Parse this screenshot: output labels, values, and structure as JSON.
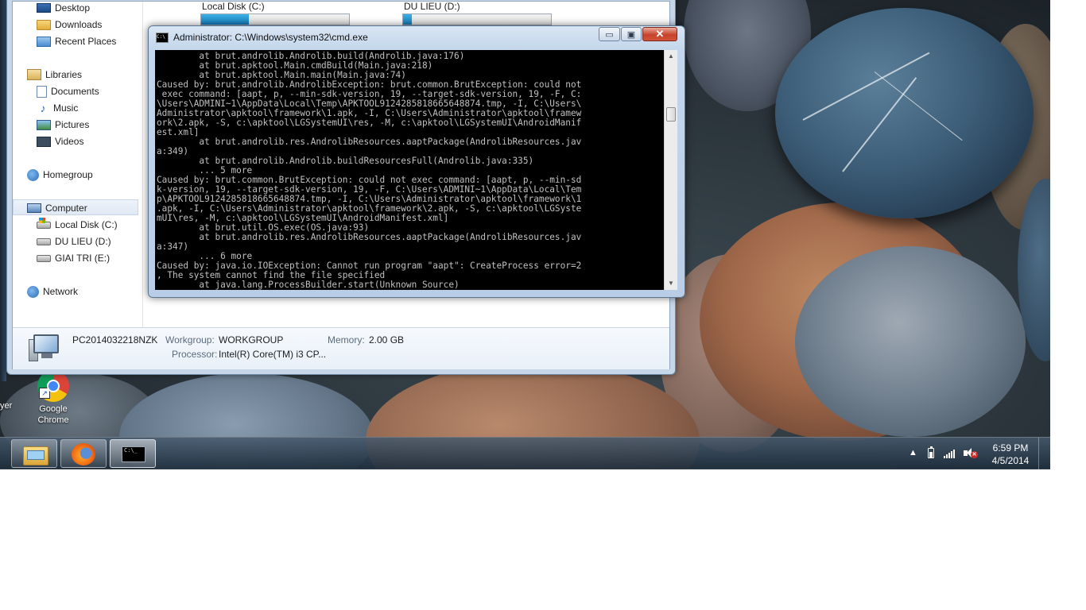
{
  "explorer": {
    "nav": {
      "desktop": "Desktop",
      "downloads": "Downloads",
      "recent_places": "Recent Places",
      "libraries": "Libraries",
      "documents": "Documents",
      "music": "Music",
      "pictures": "Pictures",
      "videos": "Videos",
      "homegroup": "Homegroup",
      "computer": "Computer",
      "local_disk": "Local Disk (C:)",
      "du_lieu": "DU LIEU (D:)",
      "giai_tri": "GIAI TRI (E:)",
      "network": "Network"
    },
    "drives": [
      {
        "label": "Local Disk (C:)",
        "used_fraction": 0.32
      },
      {
        "label": "DU LIEU (D:)",
        "used_fraction": 0.06
      }
    ],
    "details": {
      "computer_name": "PC2014032218NZK",
      "workgroup_label": "Workgroup:",
      "workgroup_value": "WORKGROUP",
      "memory_label": "Memory:",
      "memory_value": "2.00 GB",
      "processor_label": "Processor:",
      "processor_value": "Intel(R) Core(TM) i3 CP..."
    }
  },
  "cmd": {
    "title": "Administrator: C:\\Windows\\system32\\cmd.exe",
    "icon_text": "C:\\",
    "min_glyph": "▭",
    "max_glyph": "▣",
    "close_glyph": "✕",
    "output": "        at brut.androlib.Androlib.build(Androlib.java:176)\n        at brut.apktool.Main.cmdBuild(Main.java:218)\n        at brut.apktool.Main.main(Main.java:74)\nCaused by: brut.androlib.AndrolibException: brut.common.BrutException: could not\n exec command: [aapt, p, --min-sdk-version, 19, --target-sdk-version, 19, -F, C:\n\\Users\\ADMINI~1\\AppData\\Local\\Temp\\APKTOOL9124285818665648874.tmp, -I, C:\\Users\\\nAdministrator\\apktool\\framework\\1.apk, -I, C:\\Users\\Administrator\\apktool\\framew\nork\\2.apk, -S, c:\\apktool\\LGSystemUI\\res, -M, c:\\apktool\\LGSystemUI\\AndroidManif\nest.xml]\n        at brut.androlib.res.AndrolibResources.aaptPackage(AndrolibResources.jav\na:349)\n        at brut.androlib.Androlib.buildResourcesFull(Androlib.java:335)\n        ... 5 more\nCaused by: brut.common.BrutException: could not exec command: [aapt, p, --min-sd\nk-version, 19, --target-sdk-version, 19, -F, C:\\Users\\ADMINI~1\\AppData\\Local\\Tem\np\\APKTOOL9124285818665648874.tmp, -I, C:\\Users\\Administrator\\apktool\\framework\\1\n.apk, -I, C:\\Users\\Administrator\\apktool\\framework\\2.apk, -S, c:\\apktool\\LGSyste\nmUI\\res, -M, c:\\apktool\\LGSystemUI\\AndroidManifest.xml]\n        at brut.util.OS.exec(OS.java:93)\n        at brut.androlib.res.AndrolibResources.aaptPackage(AndrolibResources.jav\na:347)\n        ... 6 more\nCaused by: java.io.IOException: Cannot run program \"aapt\": CreateProcess error=2\n, The system cannot find the file specified\n        at java.lang.ProcessBuilder.start(Unknown Source)"
  },
  "desktop": {
    "chrome_label": "Google Chrome",
    "left_edge_label": "yer"
  },
  "taskbar": {
    "cmd_icon_text": "C:\\_",
    "tray_arrow": "▲",
    "clock_time": "6:59 PM",
    "clock_date": "4/5/2014"
  }
}
